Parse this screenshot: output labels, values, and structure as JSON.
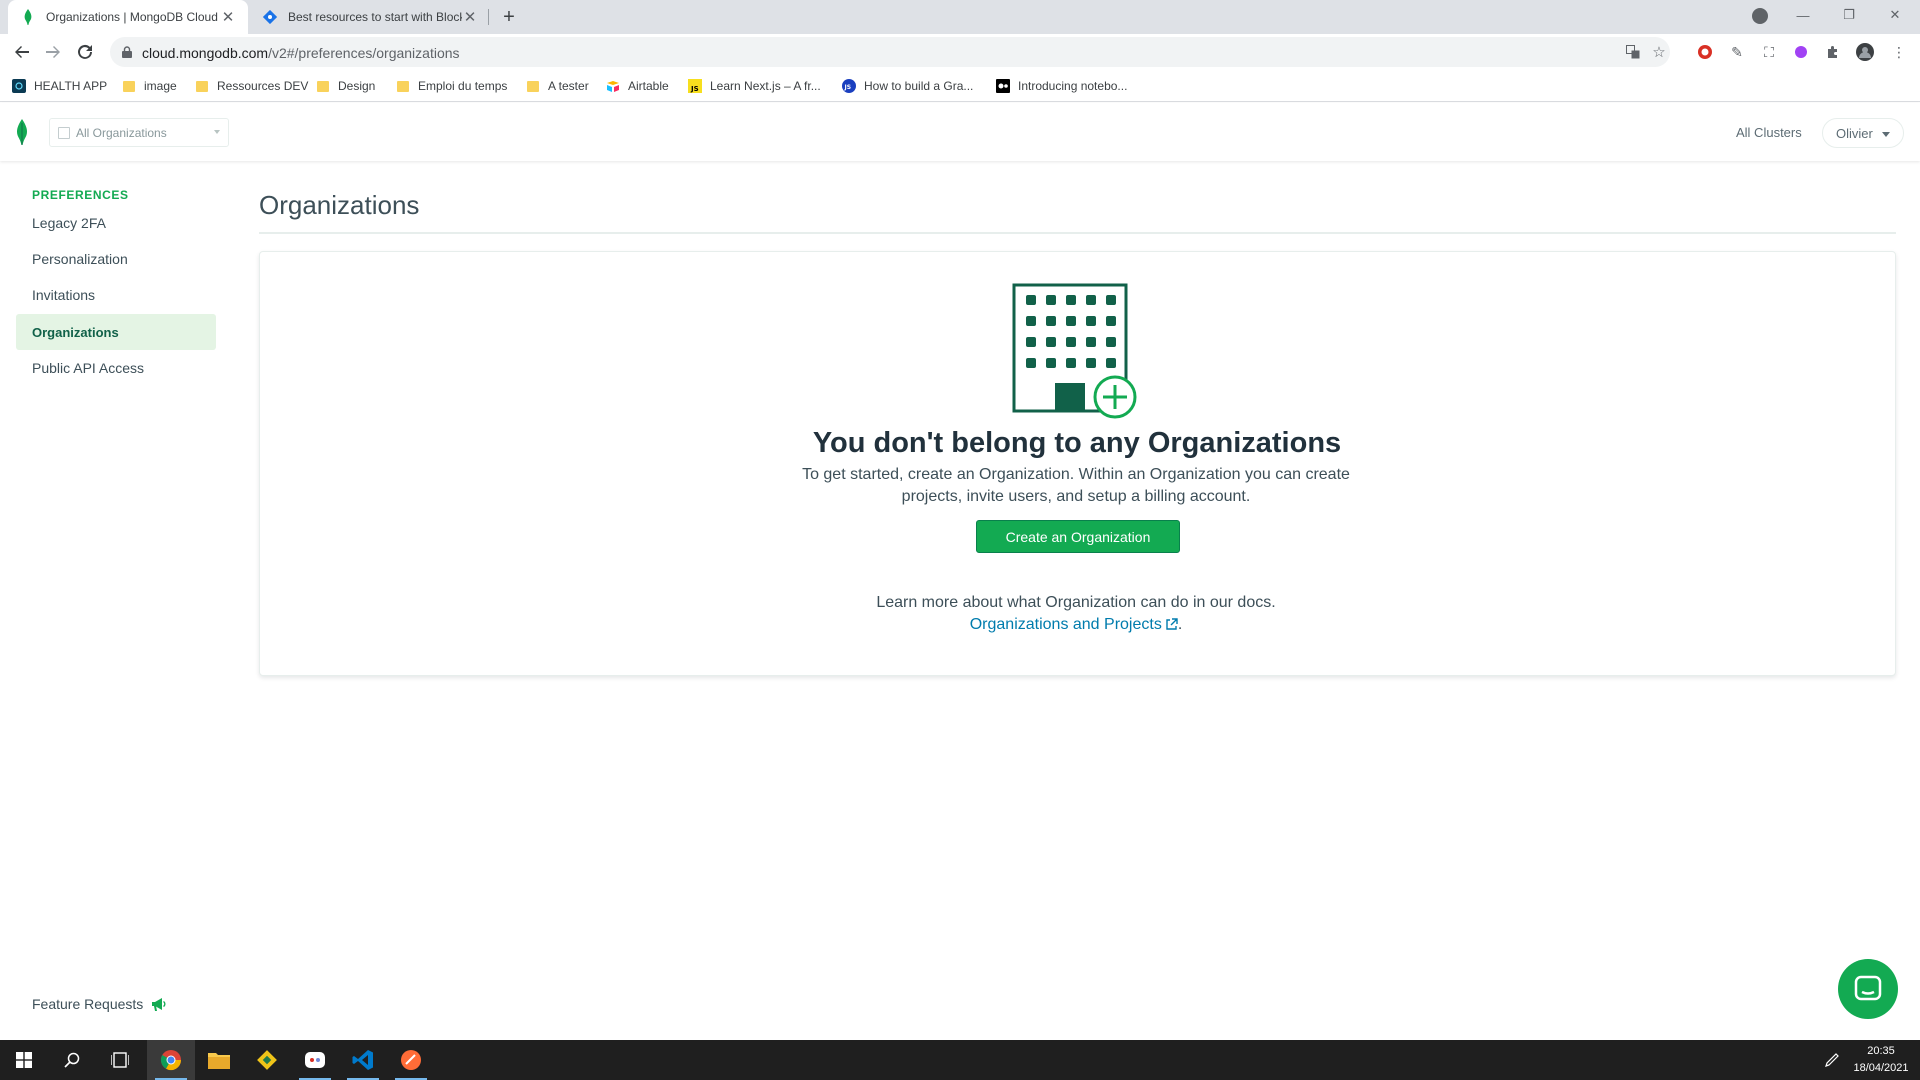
{
  "browser": {
    "tabs": [
      {
        "title": "Organizations | MongoDB Cloud",
        "active": true
      },
      {
        "title": "Best resources to start with Block",
        "active": false
      }
    ],
    "url_host": "cloud.mongodb.com",
    "url_path": "/v2#/preferences/organizations",
    "bookmarks": [
      {
        "label": "HEALTH APP",
        "icon": "app-icon"
      },
      {
        "label": "image",
        "icon": "folder-icon"
      },
      {
        "label": "Ressources DEV",
        "icon": "folder-icon"
      },
      {
        "label": "Design",
        "icon": "folder-icon"
      },
      {
        "label": "Emploi du temps",
        "icon": "folder-icon"
      },
      {
        "label": "A tester",
        "icon": "folder-icon"
      },
      {
        "label": "Airtable",
        "icon": "airtable-icon"
      },
      {
        "label": "Learn Next.js – A fr...",
        "icon": "js-icon"
      },
      {
        "label": "How to build a Gra...",
        "icon": "globe-icon"
      },
      {
        "label": "Introducing notebo...",
        "icon": "notebook-icon"
      }
    ]
  },
  "appnav": {
    "org_selector": "All Organizations",
    "all_clusters": "All Clusters",
    "user": "Olivier"
  },
  "sidebar": {
    "heading": "PREFERENCES",
    "items": [
      {
        "label": "Legacy 2FA",
        "active": false
      },
      {
        "label": "Personalization",
        "active": false
      },
      {
        "label": "Invitations",
        "active": false
      },
      {
        "label": "Organizations",
        "active": true
      },
      {
        "label": "Public API Access",
        "active": false
      }
    ],
    "feature_requests": "Feature Requests"
  },
  "main": {
    "title": "Organizations",
    "empty_title": "You don't belong to any Organizations",
    "empty_text": "To get started, create an Organization. Within an Organization you can create projects, invite users, and setup a billing account.",
    "cta": "Create an Organization",
    "learn_text": "Learn more about what Organization can do in our docs.",
    "learn_link": "Organizations and Projects",
    "learn_suffix": "."
  },
  "taskbar": {
    "time": "20:35",
    "date": "18/04/2021"
  },
  "colors": {
    "brand_green": "#13aa52",
    "dark_green": "#116149",
    "link": "#007cad"
  }
}
